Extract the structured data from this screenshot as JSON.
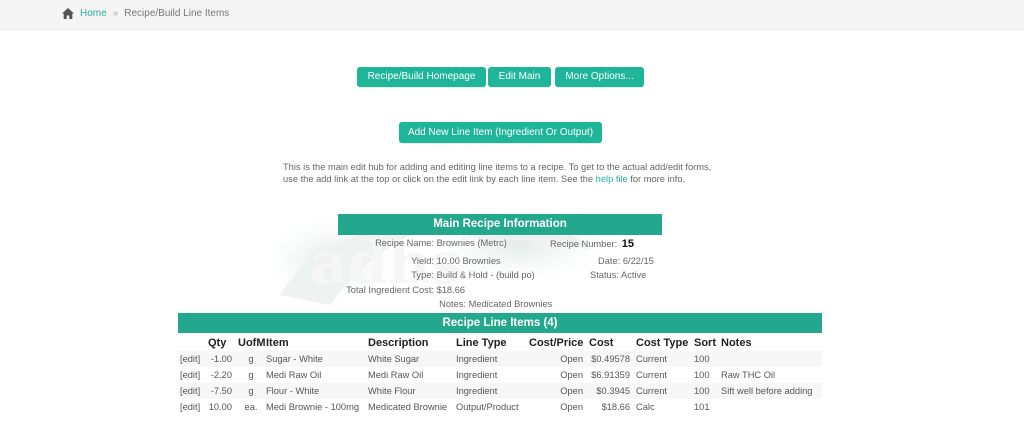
{
  "breadcrumb": {
    "home": "Home",
    "current": "Recipe/Build Line Items"
  },
  "toolbar": {
    "homepage": "Recipe/Build Homepage",
    "edit_main": "Edit Main",
    "more": "More Options..."
  },
  "add_button": "Add New Line Item (Ingredient Or Output)",
  "intro": {
    "before_link": "This is the main edit hub for adding and editing line items to a recipe. To get to the actual add/edit forms, use the add link at the top or click on the edit link by each line item. See the ",
    "link": "help file",
    "after_link": " for more info."
  },
  "watermark": "adhs",
  "main_info": {
    "title": "Main Recipe Information",
    "recipe_name_label": "Recipe Name:",
    "recipe_name": "Brownies (Metrc)",
    "recipe_number_label": "Recipe Number:",
    "recipe_number": "15",
    "yield_label": "Yield:",
    "yield": "10.00 Brownies",
    "date_label": "Date:",
    "date": "6/22/15",
    "type_label": "Type:",
    "type": "Build & Hold - (build po)",
    "status_label": "Status:",
    "status": "Active",
    "cost_label": "Total Ingredient Cost:",
    "cost": "$18.66",
    "notes_label": "Notes:",
    "notes": "Medicated Brownies"
  },
  "line_items": {
    "title": "Recipe Line Items (4)",
    "headers": {
      "qty": "Qty",
      "uofm": "UofM",
      "item": "Item",
      "description": "Description",
      "line_type": "Line Type",
      "cost_price": "Cost/Price",
      "cost": "Cost",
      "cost_type": "Cost Type",
      "sort": "Sort",
      "notes": "Notes"
    },
    "rows": [
      {
        "edit": "[edit]",
        "qty": "-1.00",
        "uofm": "g",
        "item": "Sugar - White",
        "description": "White Sugar",
        "line_type": "Ingredient",
        "cost_price": "Open",
        "cost": "$0.49578",
        "cost_type": "Current",
        "sort": "100",
        "notes": ""
      },
      {
        "edit": "[edit]",
        "qty": "-2.20",
        "uofm": "g",
        "item": "Medi Raw Oil",
        "description": "Medi Raw Oil",
        "line_type": "Ingredient",
        "cost_price": "Open",
        "cost": "$6.91359",
        "cost_type": "Current",
        "sort": "100",
        "notes": "Raw THC Oil"
      },
      {
        "edit": "[edit]",
        "qty": "-7.50",
        "uofm": "g",
        "item": "Flour - White",
        "description": "White Flour",
        "line_type": "Ingredient",
        "cost_price": "Open",
        "cost": "$0.3945",
        "cost_type": "Current",
        "sort": "100",
        "notes": "Sift well before adding"
      },
      {
        "edit": "[edit]",
        "qty": "10.00",
        "uofm": "ea.",
        "item": "Medi Brownie - 100mg",
        "description": "Medicated Brownie",
        "line_type": "Output/Product",
        "cost_price": "Open",
        "cost": "$18.66",
        "cost_type": "Calc",
        "sort": "101",
        "notes": ""
      }
    ]
  },
  "colors": {
    "accent": "#1fb599",
    "header_bar": "#23a88d",
    "link": "#22b39a"
  }
}
